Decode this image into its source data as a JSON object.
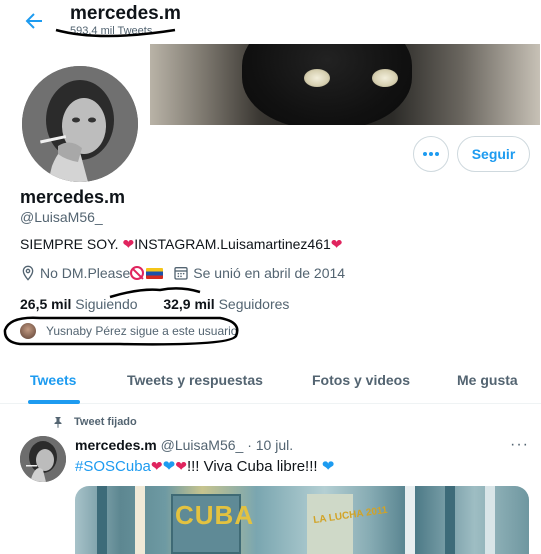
{
  "header": {
    "name": "mercedes.m",
    "tweet_count": "593,4 mil Tweets"
  },
  "profile": {
    "name": "mercedes.m",
    "handle": "@LuisaM56_",
    "bio_text_1": "SIEMPRE SOY. ",
    "bio_text_2": "INSTAGRAM.Luisamartinez461",
    "location": "No DM.Please",
    "joined": "Se unió en abril de 2014",
    "following_count": "26,5 mil",
    "following_label": " Siguiendo",
    "followers_count": "32,9 mil",
    "followers_label": " Seguidores",
    "followed_by": "Yusnaby Pérez sigue a este usuario",
    "follow_button": "Seguir",
    "more_button": "•••"
  },
  "tabs": [
    {
      "label": "Tweets",
      "active": true
    },
    {
      "label": "Tweets y respuestas",
      "active": false
    },
    {
      "label": "Fotos y videos",
      "active": false
    },
    {
      "label": "Me gusta",
      "active": false
    }
  ],
  "pinned_tweet": {
    "pinned_label": "Tweet fijado",
    "name": "mercedes.m",
    "handle": "@LuisaM56_",
    "date": " · 10 jul.",
    "hashtag": "#SOSCuba",
    "text_mid": "!!! Viva Cuba libre!!! ",
    "more": "···",
    "media_sign_text": "CUBA",
    "media_poster_text": "LA LUCHA 2011"
  },
  "colors": {
    "accent": "#1d9bf0",
    "heart": "#e0245e",
    "secondary_text": "#536471"
  }
}
